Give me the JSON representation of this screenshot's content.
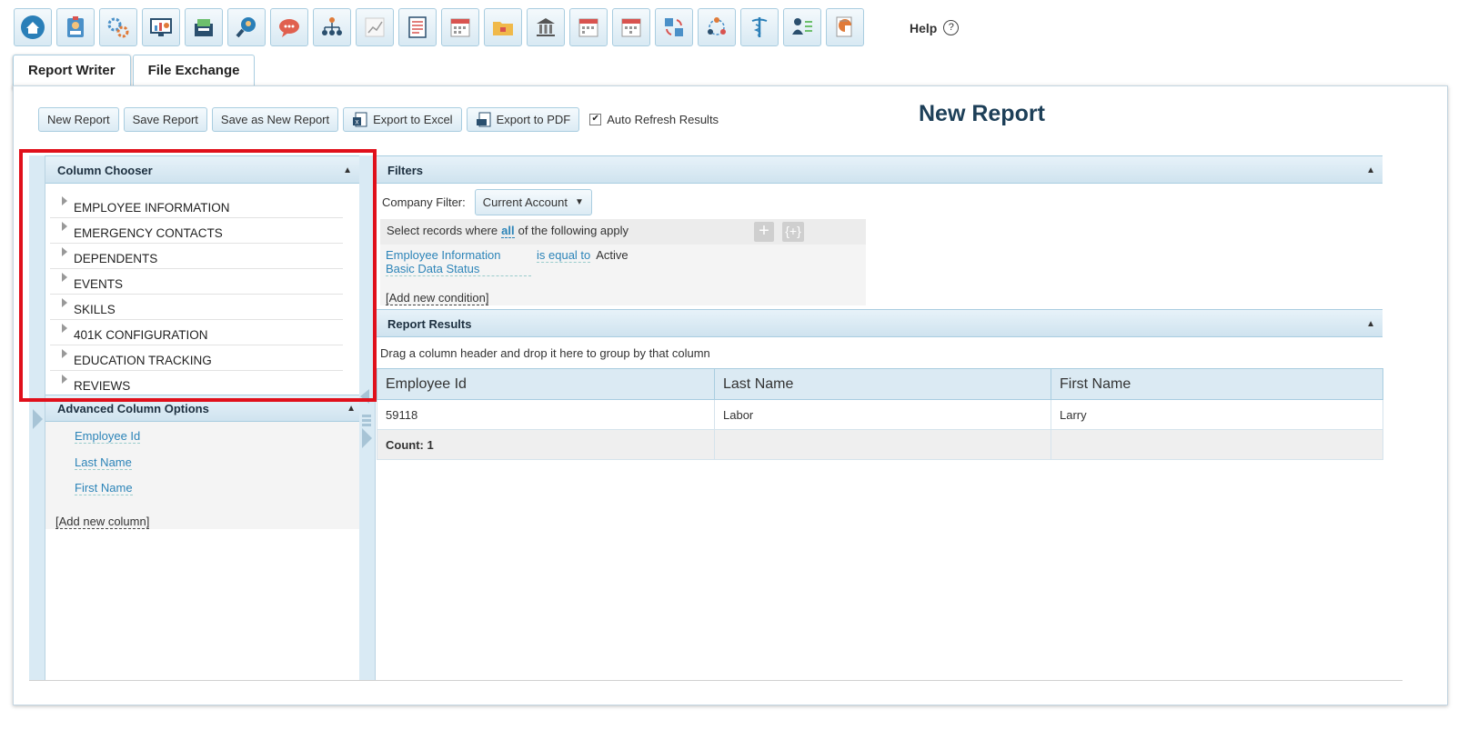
{
  "toolbar": {
    "icons": [
      "home-icon",
      "id-card-icon",
      "gears-icon",
      "dashboard-icon",
      "payroll-icon",
      "search-person-icon",
      "chat-icon",
      "org-chart-icon",
      "line-chart-icon",
      "checklist-icon",
      "calendar-icon",
      "folder-lock-icon",
      "bank-icon",
      "calendar-icon",
      "calendar-icon",
      "sync-icon",
      "network-icon",
      "caduceus-icon",
      "person-checklist-icon",
      "pie-report-icon"
    ],
    "help_label": "Help",
    "help_icon": "?"
  },
  "tabs": [
    {
      "label": "Report Writer",
      "active": true
    },
    {
      "label": "File Exchange",
      "active": false
    }
  ],
  "actions": {
    "new_report": "New Report",
    "save_report": "Save Report",
    "save_as_new": "Save as New Report",
    "export_excel": "Export to Excel",
    "export_pdf": "Export to PDF",
    "auto_refresh": "Auto Refresh Results",
    "auto_refresh_checked": true
  },
  "page_title": "New Report",
  "column_chooser": {
    "title": "Column Chooser",
    "items": [
      "EMPLOYEE INFORMATION",
      "EMERGENCY CONTACTS",
      "DEPENDENTS",
      "EVENTS",
      "SKILLS",
      "401K CONFIGURATION",
      "EDUCATION TRACKING",
      "REVIEWS"
    ]
  },
  "advanced": {
    "title": "Advanced Column Options",
    "columns": [
      "Employee Id",
      "Last Name",
      "First Name"
    ],
    "add_column": "[Add new column]"
  },
  "filters": {
    "title": "Filters",
    "company_label": "Company Filter:",
    "company_value": "Current Account",
    "select_prefix": "Select records where",
    "select_all": "all",
    "select_suffix": "of the following apply",
    "condition_field": "Employee Information Basic Data Status",
    "condition_operator": "is equal to",
    "condition_value": "Active",
    "add_condition": "[Add new condition]"
  },
  "results": {
    "title": "Report Results",
    "group_hint": "Drag a column header and drop it here to group by that column",
    "columns": [
      "Employee Id",
      "Last Name",
      "First Name"
    ],
    "rows": [
      [
        "59118",
        "Labor",
        "Larry"
      ]
    ],
    "count_label": "Count: 1"
  }
}
